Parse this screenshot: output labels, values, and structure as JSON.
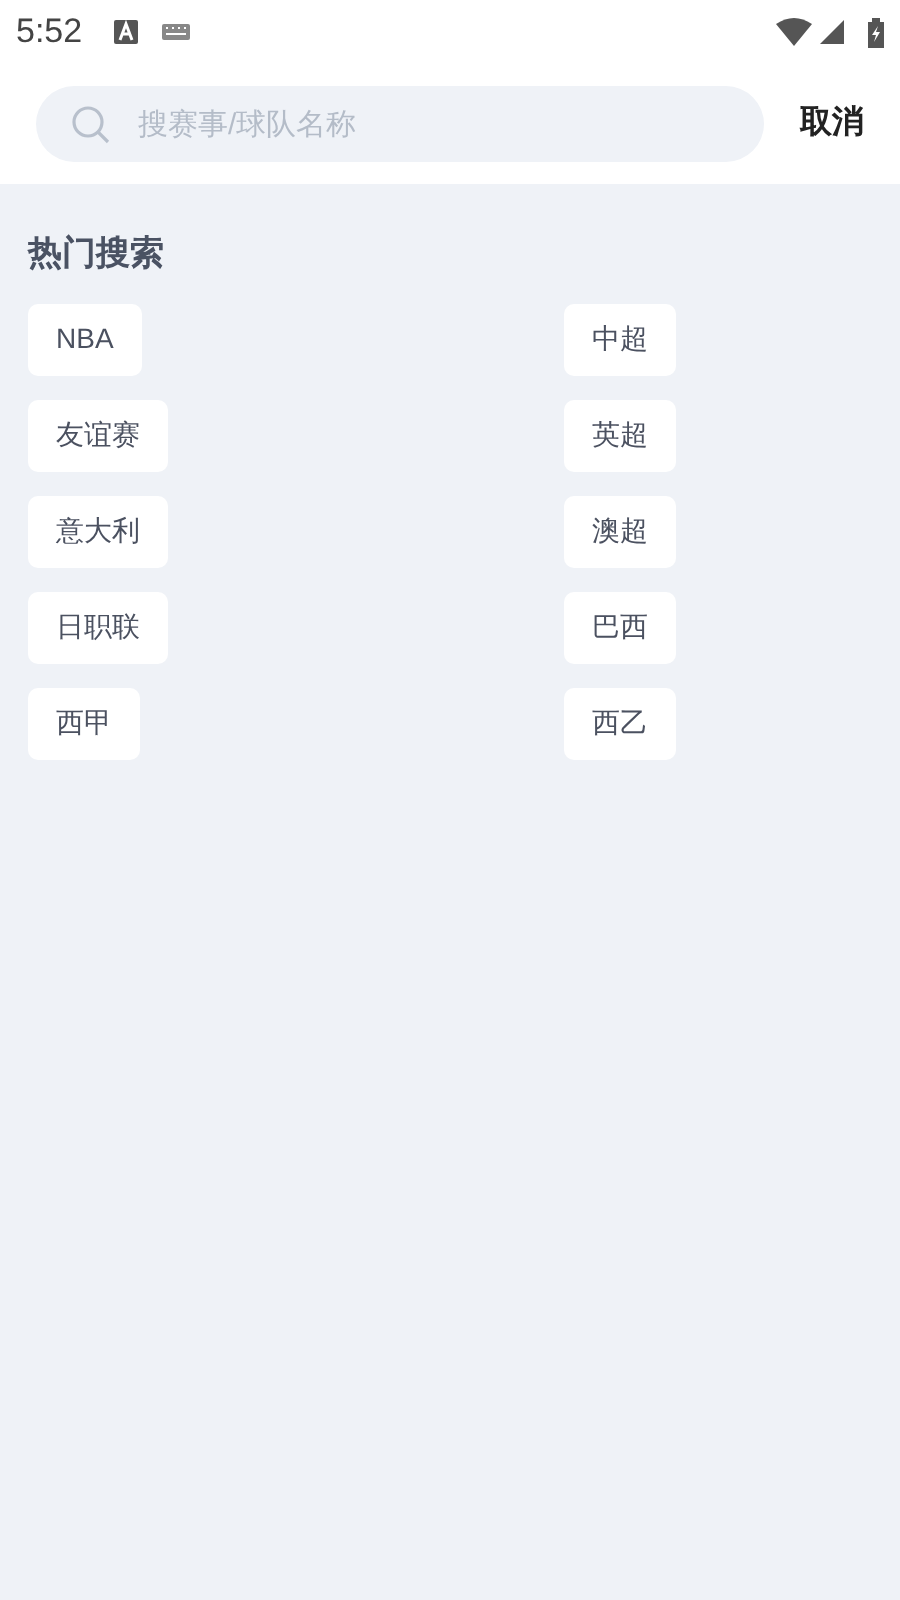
{
  "status_bar": {
    "time": "5:52"
  },
  "search": {
    "placeholder": "搜赛事/球队名称",
    "cancel": "取消"
  },
  "hot": {
    "title": "热门搜索",
    "tags": [
      {
        "label": "NBA"
      },
      {
        "label": "中超"
      },
      {
        "label": "友谊赛"
      },
      {
        "label": "英超"
      },
      {
        "label": "意大利"
      },
      {
        "label": "澳超"
      },
      {
        "label": "日职联"
      },
      {
        "label": "巴西"
      },
      {
        "label": "西甲"
      },
      {
        "label": "西乙"
      }
    ]
  }
}
